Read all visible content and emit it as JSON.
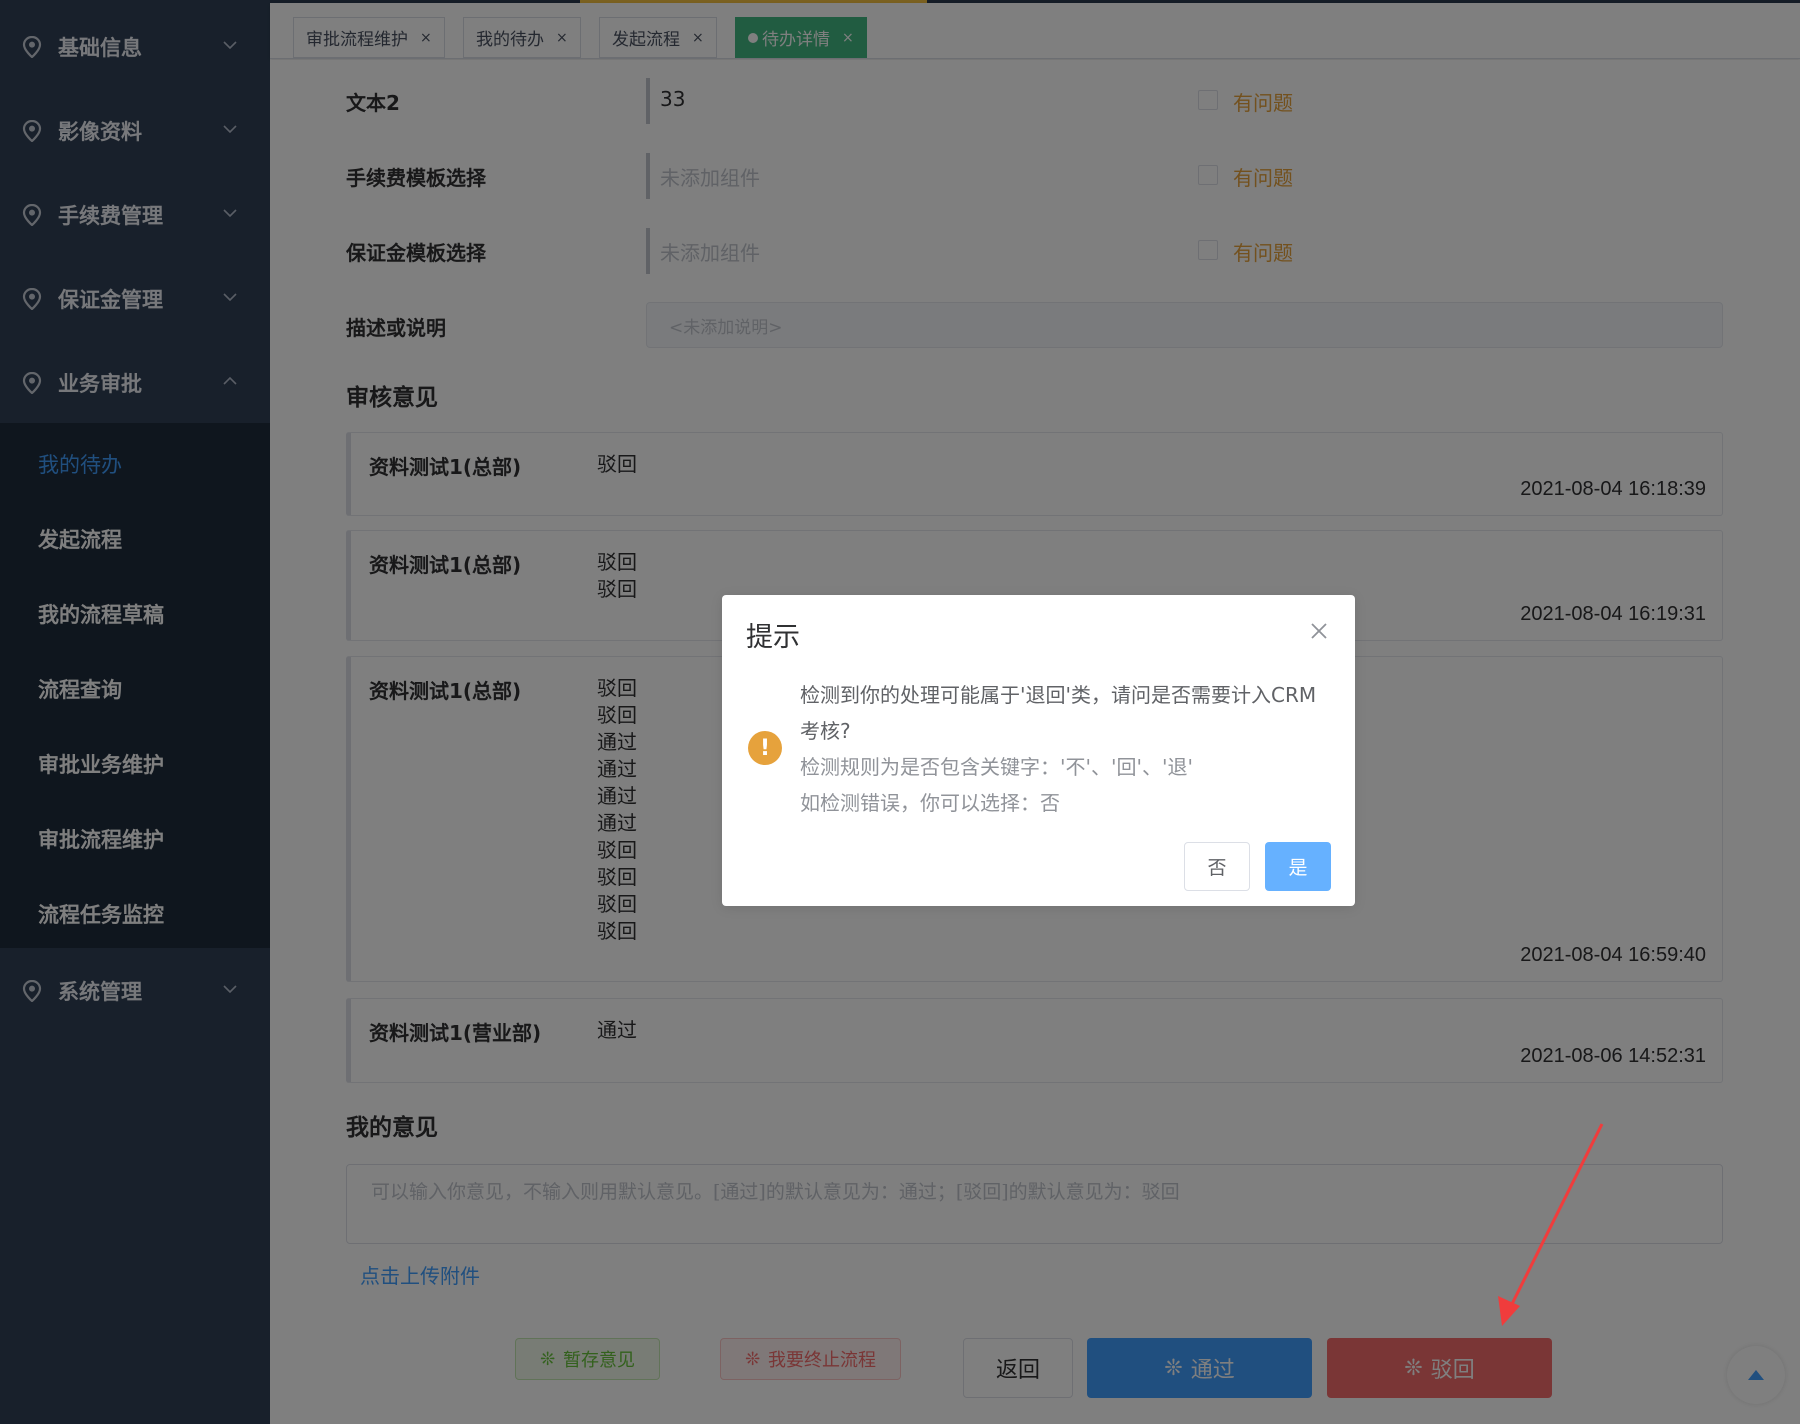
{
  "sidebar": {
    "groups": [
      {
        "label": "基础信息",
        "icon": "location-pin-icon"
      },
      {
        "label": "影像资料",
        "icon": "location-pin-icon"
      },
      {
        "label": "手续费管理",
        "icon": "location-pin-icon"
      },
      {
        "label": "保证金管理",
        "icon": "location-pin-icon"
      },
      {
        "label": "业务审批",
        "icon": "location-pin-icon"
      },
      {
        "label": "系统管理",
        "icon": "location-pin-icon"
      }
    ],
    "sub_items": [
      "我的待办",
      "发起流程",
      "我的流程草稿",
      "流程查询",
      "审批业务维护",
      "审批流程维护",
      "流程任务监控"
    ],
    "active_sub": "我的待办"
  },
  "tabs": [
    {
      "label": "审批流程维护"
    },
    {
      "label": "我的待办"
    },
    {
      "label": "发起流程"
    },
    {
      "label": "待办详情",
      "active": true
    }
  ],
  "form": {
    "fields": [
      {
        "label": "文本2",
        "value": "33",
        "problem_label": "有问题"
      },
      {
        "label": "手续费模板选择",
        "value": "未添加组件",
        "problem_label": "有问题"
      },
      {
        "label": "保证金模板选择",
        "value": "未添加组件",
        "problem_label": "有问题"
      }
    ],
    "desc_label": "描述或说明",
    "desc_placeholder": "<未添加说明>"
  },
  "review": {
    "title": "审核意见",
    "records": [
      {
        "who": "资料测试1(总部)",
        "ops": [
          "驳回"
        ],
        "time": "2021-08-04 16:18:39"
      },
      {
        "who": "资料测试1(总部)",
        "ops": [
          "驳回",
          "驳回"
        ],
        "time": "2021-08-04 16:19:31"
      },
      {
        "who": "资料测试1(总部)",
        "ops": [
          "驳回",
          "驳回",
          "通过",
          "通过",
          "通过",
          "通过",
          "驳回",
          "驳回",
          "驳回",
          "驳回"
        ],
        "time": "2021-08-04 16:59:40"
      },
      {
        "who": "资料测试1(营业部)",
        "ops": [
          "通过"
        ],
        "time": "2021-08-06 14:52:31"
      }
    ]
  },
  "opinion": {
    "title": "我的意见",
    "placeholder": "可以输入你意见，不输入则用默认意见。[通过]的默认意见为：通过；[驳回]的默认意见为：驳回",
    "upload_label": "点击上传附件"
  },
  "actions": {
    "save": "暂存意见",
    "stop": "我要终止流程",
    "back": "返回",
    "pass": "通过",
    "reject": "驳回"
  },
  "dialog": {
    "title": "提示",
    "line1": "检测到你的处理可能属于'退回'类，请问是否需要计入CRM考核?",
    "line2": "检测规则为是否包含关键字：'不'、'回'、'退'",
    "line3": "如检测错误，你可以选择：否",
    "no_label": "否",
    "yes_label": "是"
  },
  "colors": {
    "sidebar_bg": "#304156",
    "submenu_bg": "#1f2d3d",
    "active_tab": "#42b983",
    "primary": "#409eff",
    "danger": "#f56c6c",
    "warning": "#e6a23c",
    "success": "#67c23a"
  }
}
